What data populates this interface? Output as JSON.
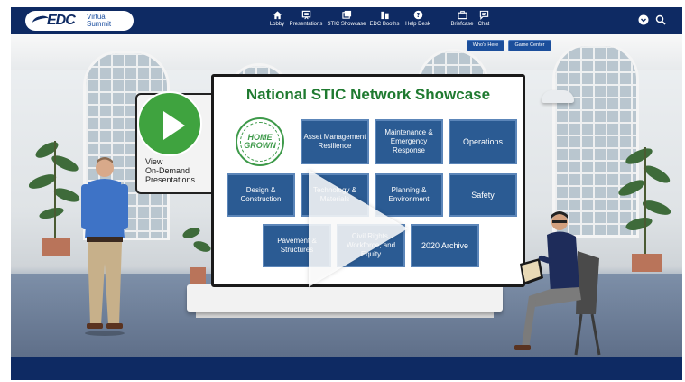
{
  "header": {
    "logo_text": "EDC",
    "logo_sub1": "Virtual",
    "logo_sub2": "Summit",
    "nav": [
      {
        "label": "Lobby",
        "icon": "home-icon"
      },
      {
        "label": "Presentations",
        "icon": "presentation-icon"
      },
      {
        "label": "STIC Showcase",
        "icon": "showcase-icon"
      },
      {
        "label": "EDC Booths",
        "icon": "booth-icon"
      },
      {
        "label": "Help Desk",
        "icon": "help-icon"
      },
      {
        "label": "Briefcase",
        "icon": "briefcase-icon"
      },
      {
        "label": "Chat",
        "icon": "chat-icon"
      }
    ],
    "right_icons": [
      "chevron-down-icon",
      "search-icon"
    ],
    "color": "#0e2a63"
  },
  "scene": {
    "buttons": {
      "whos_here": "Who's Here",
      "game_center": "Game Center"
    },
    "ondemand": {
      "line1": "View",
      "line2": "On-Demand",
      "line3": "Presentations"
    },
    "board": {
      "title": "National STIC Network Showcase",
      "badge": {
        "line1": "HOME GROWN"
      },
      "tiles": [
        "Asset Management Resilience",
        "Maintenance & Emergency Response",
        "Operations",
        "Design & Construction",
        "Technology & Materials",
        "Planning & Environment",
        "Safety",
        "Pavement & Structures",
        "Civil Rights, Workforce, and Equity",
        "2020 Archive"
      ],
      "title_color": "#1f7a30",
      "tile_color": "#2b5b93"
    },
    "play_icon": "play-icon"
  }
}
